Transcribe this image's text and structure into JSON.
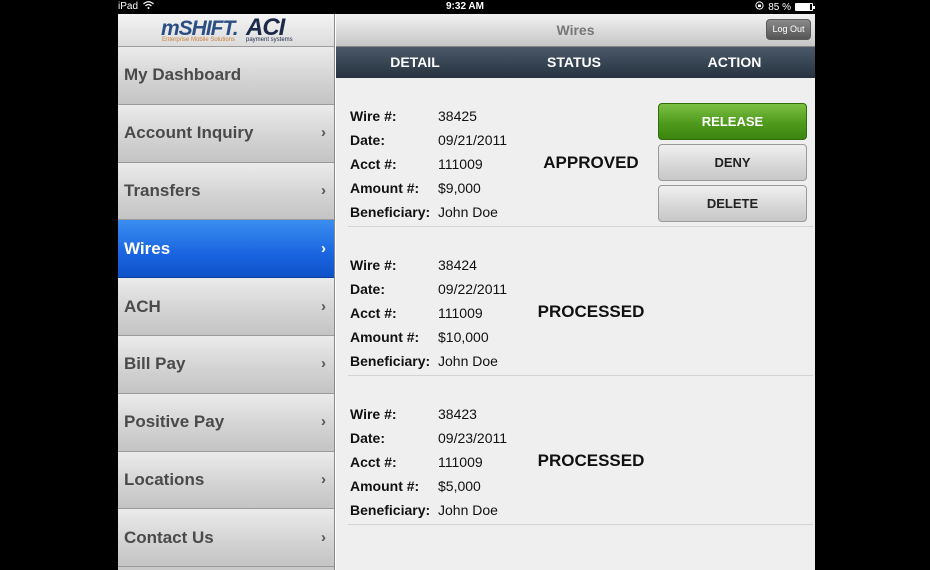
{
  "statusbar": {
    "device": "iPad",
    "time": "9:32 AM",
    "battery": "85 %",
    "battery_level": 0.85
  },
  "logo": {
    "brand": "mSHIFT.",
    "brand_tagline": "Enterprise Mobile Solutions",
    "partner": "ACI",
    "partner_tagline": "payment systems"
  },
  "sidebar": {
    "items": [
      {
        "label": "My Dashboard",
        "active": false
      },
      {
        "label": "Account Inquiry",
        "active": false
      },
      {
        "label": "Transfers",
        "active": false
      },
      {
        "label": "Wires",
        "active": true
      },
      {
        "label": "ACH",
        "active": false
      },
      {
        "label": "Bill Pay",
        "active": false
      },
      {
        "label": "Positive Pay",
        "active": false
      },
      {
        "label": "Locations",
        "active": false
      },
      {
        "label": "Contact Us",
        "active": false
      }
    ],
    "chevron": "›"
  },
  "header": {
    "title": "Wires",
    "logout_label": "Log Out"
  },
  "columns": {
    "detail": "DETAIL",
    "status": "STATUS",
    "action": "ACTION"
  },
  "field_labels": {
    "wire": "Wire #:",
    "date": "Date:",
    "acct": "Acct #:",
    "amount": "Amount #:",
    "beneficiary": "Beneficiary:"
  },
  "wires": [
    {
      "wire": "38425",
      "date": "09/21/2011",
      "acct": "111009",
      "amount": "$9,000",
      "beneficiary": "John Doe",
      "status": "APPROVED"
    },
    {
      "wire": "38424",
      "date": "09/22/2011",
      "acct": "111009",
      "amount": "$10,000",
      "beneficiary": "John Doe",
      "status": "PROCESSED"
    },
    {
      "wire": "38423",
      "date": "09/23/2011",
      "acct": "111009",
      "amount": "$5,000",
      "beneficiary": "John Doe",
      "status": "PROCESSED"
    }
  ],
  "actions": {
    "release": "RELEASE",
    "deny": "DENY",
    "delete": "DELETE"
  },
  "colors": {
    "active_nav": "#1a64e0",
    "release_green": "#4f9a1c",
    "header_dark": "#26323f"
  },
  "icons": {
    "wifi": "wifi-icon",
    "battery": "battery-icon",
    "orientation_lock": "orientation-lock-icon"
  }
}
